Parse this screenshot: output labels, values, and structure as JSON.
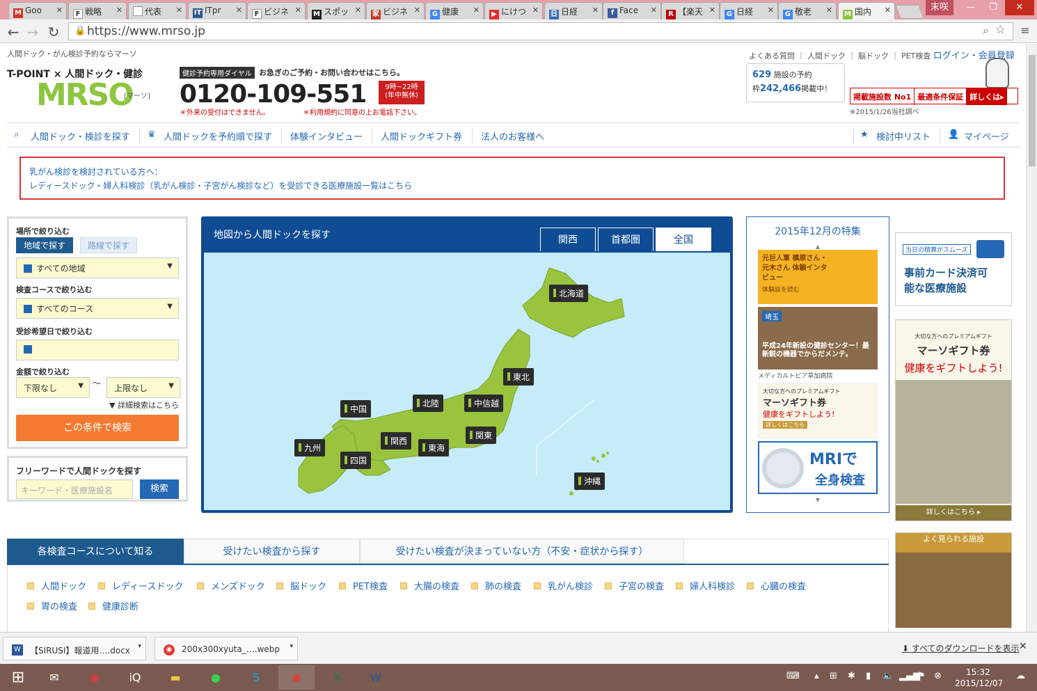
{
  "browser": {
    "tabs": [
      {
        "label": "Goo",
        "icon": "gmail-icon",
        "color": "#d93025",
        "glyph": "M"
      },
      {
        "label": "戦略",
        "icon": "f-icon",
        "color": "#ffffff",
        "glyph": "F"
      },
      {
        "label": "代表",
        "icon": "doc-icon",
        "color": "#ffffff",
        "glyph": ""
      },
      {
        "label": "ITpr",
        "icon": "itpro-icon",
        "color": "#2d5b8f",
        "glyph": "IT"
      },
      {
        "label": "ビジネ",
        "icon": "f-icon",
        "color": "#ffffff",
        "glyph": "F"
      },
      {
        "label": "スポッ",
        "icon": "m-icon",
        "color": "#222222",
        "glyph": "M"
      },
      {
        "label": "ビジネ",
        "icon": "house-icon",
        "color": "#c0392b",
        "glyph": "家"
      },
      {
        "label": "健康",
        "icon": "google-icon",
        "color": "#4285f4",
        "glyph": "G"
      },
      {
        "label": "にけつ",
        "icon": "youtube-icon",
        "color": "#e52d27",
        "glyph": "▶"
      },
      {
        "label": "日経",
        "icon": "nikkei-icon",
        "color": "#3b6fb6",
        "glyph": "日"
      },
      {
        "label": "Face",
        "icon": "facebook-icon",
        "color": "#3b5998",
        "glyph": "f"
      },
      {
        "label": "【楽天",
        "icon": "rakuten-icon",
        "color": "#bf0000",
        "glyph": "R"
      },
      {
        "label": "日経",
        "icon": "google-icon",
        "color": "#4285f4",
        "glyph": "G"
      },
      {
        "label": "敬老",
        "icon": "google-icon",
        "color": "#4285f4",
        "glyph": "G"
      },
      {
        "label": "国内",
        "icon": "mrso-icon",
        "color": "#8cc63f",
        "glyph": "M",
        "active": true
      }
    ],
    "window_user": "末咲",
    "url": "https://www.mrso.jp"
  },
  "header": {
    "tagline": "人間ドック・がん検診予約ならマーソ",
    "tpoint": "T-POINT × 人間ドック・健診",
    "logo": "MRSO",
    "logo_sub": "[マーソ]",
    "dial_label": "健診予約専用ダイヤル",
    "dial_msg": "お急ぎのご予約・お問い合わせはこちら。",
    "phone": "0120-109-551",
    "hours": "9時~22時\n(年中無休)",
    "warn1": "＊外来の受付はできません。",
    "warn2": "＊利用規約に同意の上お電話下さい。",
    "toplinks": "よくある質問 ｜ 人間ドック ｜ 脳ドック ｜ PET検査",
    "login": "ログイン・会員登録",
    "stats_facilities": "629",
    "stats_facilities_label": "施設の予約",
    "stats_slots_prefix": "枠",
    "stats_slots": "242,466",
    "stats_slots_label": "掲載中！",
    "ban1": "掲載施設数 No1",
    "ban2": "最適条件保証",
    "ban3": "詳しくは▸",
    "note": "※2015/1/26当社調べ"
  },
  "nav": {
    "items": [
      "人間ドック・検診を探す",
      "人間ドックを予約順で探す",
      "体験インタビュー",
      "人間ドックギフト券",
      "法人のお客様へ"
    ],
    "watchlist": "検討中リスト",
    "mypage": "マイページ"
  },
  "notice": {
    "line1": "乳がん検診を検討されている方へ：",
    "line2": "レディースドック・婦人科検診（乳がん検診・子宮がん検診など）を受診できる医療施設一覧はこちら"
  },
  "search": {
    "place_label": "場所で絞り込む",
    "seg_region": "地域で探す",
    "seg_line": "路線で探す",
    "area_value": "すべての地域",
    "course_label": "検査コースで絞り込む",
    "course_value": "すべてのコース",
    "date_label": "受診希望日で絞り込む",
    "price_label": "金額で絞り込む",
    "price_min": "下限なし",
    "price_max": "上限なし",
    "advanced": "▼ 詳細検索はこちら",
    "submit": "この条件で検索",
    "free_label": "フリーワードで人間ドックを探す",
    "keyword_placeholder": "キーワード・医療施設名",
    "keyword_button": "検索"
  },
  "map": {
    "title": "地図から人間ドックを探す",
    "tabs": [
      "関西",
      "首都圏",
      "全国"
    ],
    "regions": [
      "北海道",
      "東北",
      "北陸",
      "中信越",
      "関東",
      "中国",
      "関西",
      "東海",
      "九州",
      "四国",
      "沖縄"
    ]
  },
  "features": {
    "title": "2015年12月の特集",
    "f1": "元巨人軍 槙原さん・元木さん 体験インタビュー",
    "f1_sub": "体験談を読む",
    "f2_tag": "埼玉",
    "f2": "平成24年新設の健診センター！最新鋭の機器でからだメンテ。",
    "f2_sub": "メディカルトピア草加病院",
    "f3_sub": "大切な方へのプレミアムギフト",
    "f3": "マーソギフト券",
    "f3_b": "健康をギフトしよう!",
    "f3_more": "詳しくはこちら",
    "f4a": "MRIで",
    "f4b": "全身検査"
  },
  "ads": {
    "card_tag": "当日の精算がスムーズ",
    "card_title": "事前カード決済可能な医療施設",
    "gift_sub": "大切な方へのプレミアムギフト",
    "gift_title": "マーソギフト券",
    "gift_red": "健康をギフトしよう!",
    "gift_more": "詳しくはこちら ▸",
    "popular": "よく見られる施設"
  },
  "bottom": {
    "tabs": [
      "各検査コースについて知る",
      "受けたい検査から探す",
      "受けたい検査が決まっていない方（不安・症状から探す）"
    ],
    "links_row1": [
      "人間ドック",
      "レディースドック",
      "メンズドック",
      "脳ドック",
      "PET検査",
      "大腸の検査",
      "肺の検査",
      "乳がん検診",
      "子宮の検査",
      "婦人科検診",
      "心臓の検査"
    ],
    "links_row2": [
      "胃の検査",
      "健康診断"
    ]
  },
  "downloads": {
    "file1": "【SIRUSI】報道用….docx",
    "file2": "200x300xyuta_….webp",
    "show_all": "すべてのダウンロードを表示"
  },
  "taskbar": {
    "time": "15:32",
    "date": "2015/12/07"
  }
}
